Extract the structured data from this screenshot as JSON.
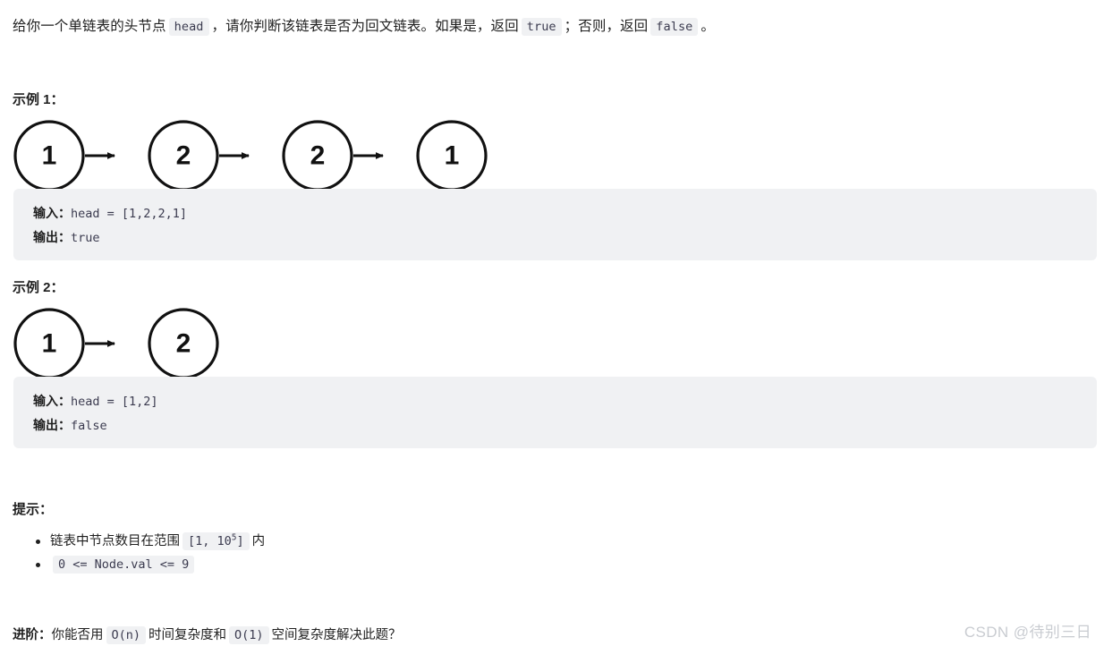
{
  "problem": {
    "description_parts": [
      {
        "type": "text",
        "text": "给你一个单链表的头节点 "
      },
      {
        "type": "code",
        "text": "head"
      },
      {
        "type": "text",
        "text": " ，请你判断该链表是否为回文链表。如果是，返回 "
      },
      {
        "type": "code",
        "text": "true"
      },
      {
        "type": "text",
        "text": " ；否则，返回 "
      },
      {
        "type": "code",
        "text": "false"
      },
      {
        "type": "text",
        "text": " 。"
      }
    ],
    "intro_text": "给你一个单链表的头节点 head ，请你判断该链表是否为回文链表。如果是，返回 true ；否则，返回 false 。",
    "intro_seg1": "给你一个单链表的头节点",
    "intro_code1": "head",
    "intro_seg2": "，请你判断该链表是否为回文链表。如果是，返回",
    "intro_code2": "true",
    "intro_seg3": "；否则，返回",
    "intro_code3": "false",
    "intro_seg4": "。"
  },
  "examples": [
    {
      "title": "示例 1：",
      "diagram": {
        "type": "linked-list",
        "nodes": [
          "1",
          "2",
          "2",
          "1"
        ]
      },
      "input_label": "输入：",
      "input_value": "head = [1,2,2,1]",
      "output_label": "输出：",
      "output_value": "true"
    },
    {
      "title": "示例 2：",
      "diagram": {
        "type": "linked-list",
        "nodes": [
          "1",
          "2"
        ]
      },
      "input_label": "输入：",
      "input_value": "head = [1,2]",
      "output_label": "输出：",
      "output_value": "false"
    }
  ],
  "hints": {
    "title": "提示：",
    "items": [
      {
        "seg1": "链表中节点数目在范围",
        "code_prefix": "[1, 10",
        "code_exp": "5",
        "code_suffix": "]",
        "seg2": "内"
      },
      {
        "code": "0 <= Node.val <= 9"
      }
    ]
  },
  "followup": {
    "lead": "进阶：",
    "seg1": "你能否用",
    "code1": "O(n)",
    "seg2": "时间复杂度和",
    "code2": "O(1)",
    "seg3": "空间复杂度解决此题？"
  },
  "watermark": {
    "text": "CSDN @待别三日"
  },
  "colors": {
    "page_background": "#ffffff",
    "code_block_background": "#f0f1f3",
    "inline_code_background": "#f0f1f3",
    "inline_code_text": "#3b3b4f",
    "body_text": "#1f1f1f",
    "node_stroke": "#111111",
    "watermark_text": "#c9ccd1"
  }
}
